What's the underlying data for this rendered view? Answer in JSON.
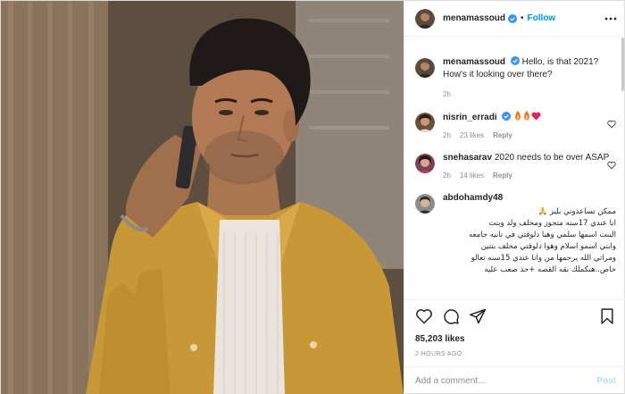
{
  "header": {
    "username": "menamassoud",
    "separator": "•",
    "follow_label": "Follow"
  },
  "caption": {
    "username": "menamassoud",
    "text": "Hello, is that 2021? How's it looking over there?",
    "time": "2h"
  },
  "comments": [
    {
      "username": "nisrin_erradi",
      "text": "",
      "time": "2h",
      "likes": "23 likes",
      "reply": "Reply"
    },
    {
      "username": "snehasarav",
      "text": "2020 needs to be over ASAP",
      "time": "2h",
      "likes": "14 likes",
      "reply": "Reply"
    },
    {
      "username": "abdohamdy48",
      "lines": [
        "ممكن تساعدوني بليز 🙏",
        "انا عندي 17سنه متجوز ومخلف ولد وبنت",
        "البنت اسمها سلمي وهيا دلوقتي في تانيه جامعه",
        "وابني اسمو اسلام وهوا دلوقتي مخلف بنتين",
        "ومراتي الله يرحمها من وانا عندي 15سنه تعالو",
        "خاص..هنكملك بقه القصه +حد صعب عليه"
      ]
    }
  ],
  "likes_count": "85,203 likes",
  "timestamp": "2 HOURS AGO",
  "add_comment": {
    "placeholder": "Add a comment…",
    "post_label": "Post"
  },
  "colors": {
    "accent": "#0095f6",
    "verified": "#3897f0",
    "muted": "#8e8e8e",
    "post_disabled": "#b2dffc"
  }
}
